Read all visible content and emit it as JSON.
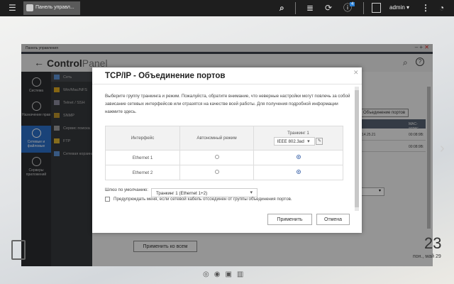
{
  "topbar": {
    "tab_label": "Панель управл...",
    "notification_count": "4",
    "user": "admin"
  },
  "window": {
    "title": "Панель управления",
    "app_name_bold": "Control",
    "app_name_light": "Panel"
  },
  "sidebar": [
    {
      "label": "Система"
    },
    {
      "label": "Назначение прав"
    },
    {
      "label": "Сетевые и файловые"
    },
    {
      "label": "Серверы приложений"
    }
  ],
  "submenu": [
    "Сеть",
    "Win/Mac/NFS",
    "Telnet / SSH",
    "SNMP",
    "Сервис поиска",
    "FTP",
    "Сетевая корзина"
  ],
  "background": {
    "port_trunk_button": "Объединение портов",
    "mac_header": "MAC-адрес",
    "ip_tail": "14.25.21",
    "mac1": "00:08:9B:",
    "mac2": "00:08:9B:",
    "apply_all": "Применить ко всем"
  },
  "clock": {
    "time": "23",
    "date": "пон., май 29"
  },
  "dialog": {
    "title": "TCP/IP - Объединение портов",
    "description": "Выберите группу транкинга и режим. Пожалуйста, обратите внимание, что неверные настройки могут повлечь за собой зависание сетевых интерфейсов или отразятся на качестве всей работы. Для получения подробной информации нажмите здесь.",
    "columns": [
      "Интерфейс",
      "Автономный режим",
      "Транкинг 1"
    ],
    "trunk_mode": "IEEE 802.3ad",
    "rows": [
      {
        "name": "Ethernet 1",
        "mode": "trunk1"
      },
      {
        "name": "Ethernet 2",
        "mode": "trunk1"
      }
    ],
    "gateway_label": "Шлюз по умолчанию:",
    "gateway_value": "Транкинг 1 (Ethernet 1+2)",
    "warn_label": "Предупреждать меня, если сетевой кабель отсоединен от группы объединения портов.",
    "warn_checked": false,
    "apply": "Применить",
    "cancel": "Отмена"
  }
}
